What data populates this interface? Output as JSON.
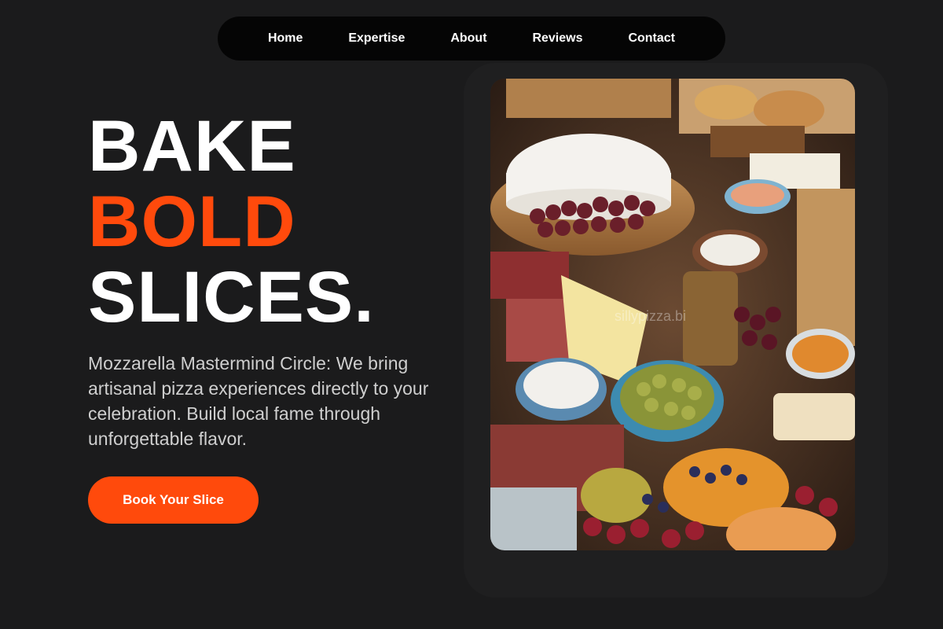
{
  "nav": {
    "items": [
      "Home",
      "Expertise",
      "About",
      "Reviews",
      "Contact"
    ]
  },
  "hero": {
    "line1": "BAKE",
    "line2": "BOLD",
    "line3": "SLICES.",
    "description": "Mozzarella Mastermind Circle: We bring artisanal pizza experiences directly to your celebration. Build local fame through unforgettable flavor.",
    "cta_label": "Book Your Slice"
  },
  "image": {
    "subject": "charcuterie-board-photo",
    "watermark": "sillypizza.bi"
  },
  "colors": {
    "background": "#1b1b1c",
    "accent": "#ff4a0c",
    "nav_background": "#050505",
    "text": "#ffffff"
  }
}
